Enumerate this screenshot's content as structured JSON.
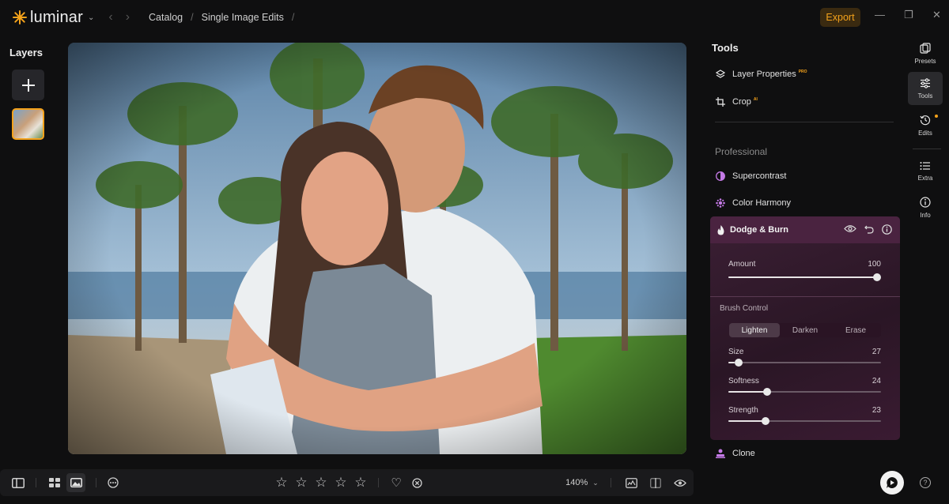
{
  "app": {
    "name": "luminar"
  },
  "breadcrumbs": [
    "Catalog",
    "Single Image Edits"
  ],
  "export_label": "Export",
  "layers": {
    "title": "Layers"
  },
  "tools": {
    "title": "Tools",
    "items": [
      {
        "label": "Layer Properties",
        "badge": "PRO"
      },
      {
        "label": "Crop",
        "badge": "AI"
      }
    ],
    "section": "Professional",
    "professional": [
      {
        "label": "Supercontrast"
      },
      {
        "label": "Color Harmony"
      }
    ],
    "dodge_burn": {
      "title": "Dodge & Burn",
      "amount": {
        "label": "Amount",
        "value": 100
      },
      "brush_title": "Brush Control",
      "modes": [
        "Lighten",
        "Darken",
        "Erase"
      ],
      "active_mode": "Lighten",
      "size": {
        "label": "Size",
        "value": 27
      },
      "softness": {
        "label": "Softness",
        "value": 24
      },
      "strength": {
        "label": "Strength",
        "value": 23
      }
    },
    "clone": {
      "label": "Clone"
    }
  },
  "sidebar": [
    "Presets",
    "Tools",
    "Edits",
    "Extra",
    "Info"
  ],
  "bottom": {
    "zoom": "140%"
  },
  "colors": {
    "accent": "#f4a21b",
    "dodge_panel": "#3b1f34",
    "dodge_icon": "#c47ae6"
  }
}
